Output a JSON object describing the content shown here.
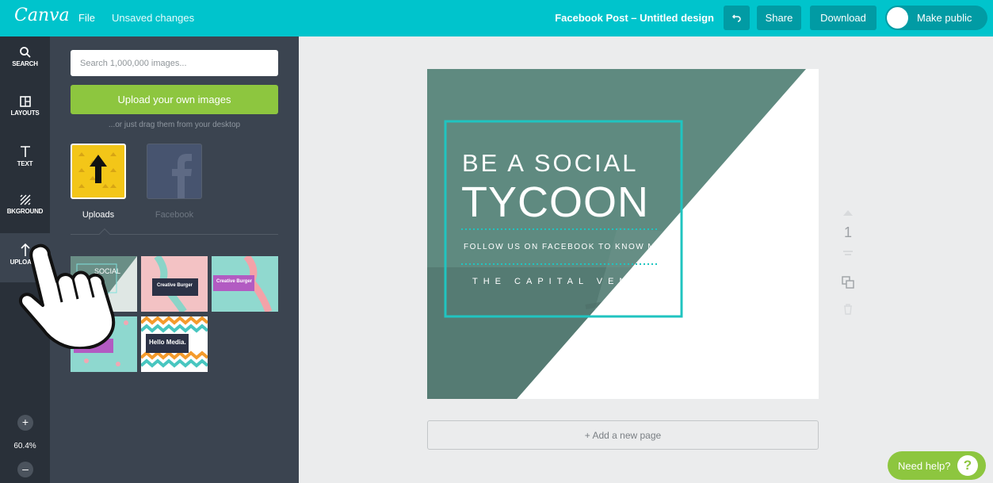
{
  "topbar": {
    "logo": "Canva",
    "file_menu": "File",
    "save_status": "Unsaved changes",
    "doc_title": "Facebook Post – Untitled design",
    "share_label": "Share",
    "download_label": "Download",
    "public_label": "Make public"
  },
  "rail": {
    "items": [
      {
        "label": "SEARCH",
        "icon": "search-icon"
      },
      {
        "label": "LAYOUTS",
        "icon": "layouts-icon"
      },
      {
        "label": "TEXT",
        "icon": "text-icon"
      },
      {
        "label": "BKGROUND",
        "icon": "background-icon"
      },
      {
        "label": "UPLOADS",
        "icon": "upload-arrow-icon"
      }
    ],
    "zoom_in": "+",
    "zoom_level": "60.4%",
    "zoom_out": "–"
  },
  "panel": {
    "search_placeholder": "Search 1,000,000 images...",
    "upload_button": "Upload your own images",
    "drag_hint": "...or just drag them from your desktop",
    "sources": [
      {
        "label": "Uploads",
        "icon": "upload-tile-icon"
      },
      {
        "label": "Facebook",
        "icon": "facebook-icon"
      }
    ],
    "thumbnails": [
      {
        "text": "SOCIAL"
      },
      {
        "text": "Creative Burger"
      },
      {
        "text": "Creative Burger"
      },
      {
        "text": ""
      },
      {
        "text": "Hello Media."
      }
    ]
  },
  "design": {
    "headline_small": "BE A SOCIAL",
    "headline_large": "TYCOON",
    "subline": "FOLLOW US ON FACEBOOK TO KNOW MO",
    "brand": "THE CAPITAL VENT"
  },
  "page_controls": {
    "page_number": "1"
  },
  "add_page": "+ Add a new page",
  "help": {
    "label": "Need help?",
    "icon": "?"
  },
  "colors": {
    "brand_teal": "#00c4cc",
    "design_green": "#5b8a7f",
    "accent_cyan": "#20c4c0",
    "upload_green": "#8dc63f"
  }
}
